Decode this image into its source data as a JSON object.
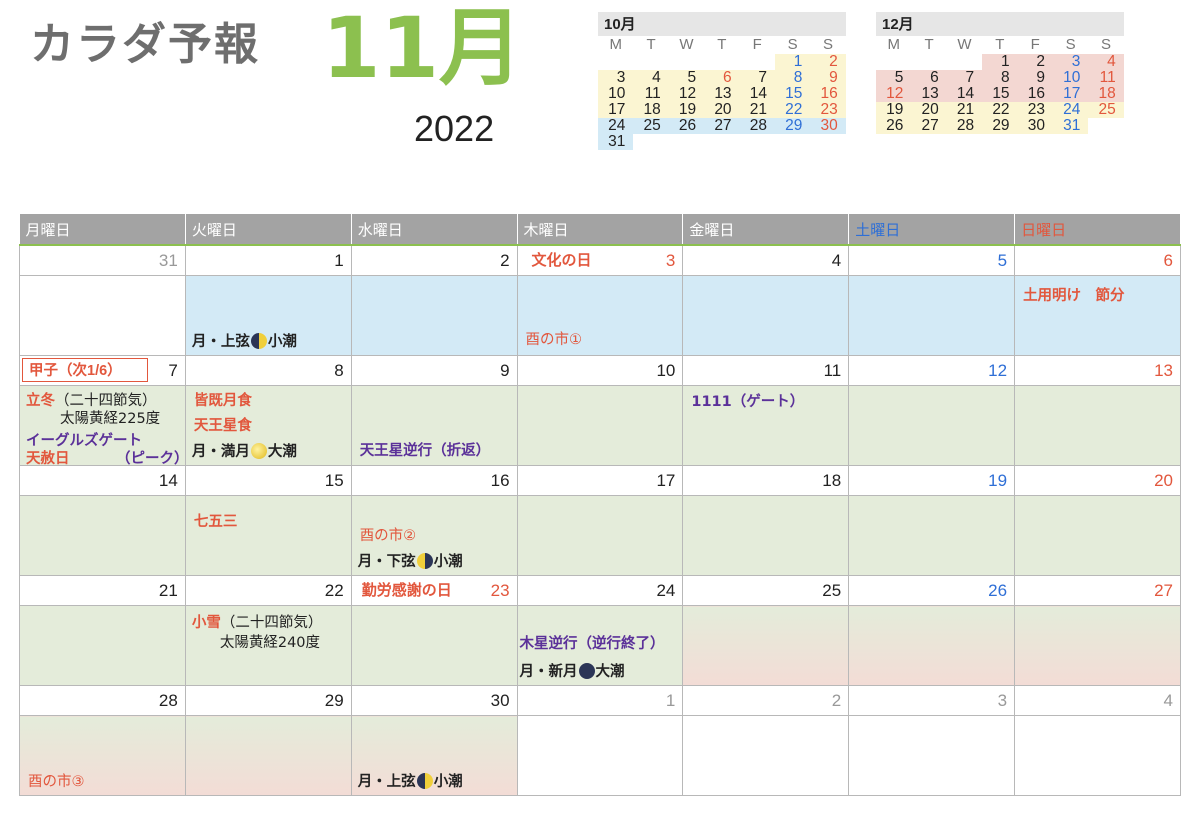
{
  "header": {
    "title": "カラダ予報",
    "month": "11月",
    "year": "2022"
  },
  "mini_oct": {
    "label": "10月",
    "dow": [
      "M",
      "T",
      "W",
      "T",
      "F",
      "S",
      "S"
    ],
    "weeks": [
      [
        "",
        "",
        "",
        "",
        "",
        "1",
        "2"
      ],
      [
        "3",
        "4",
        "5",
        "6",
        "7",
        "8",
        "9"
      ],
      [
        "10",
        "11",
        "12",
        "13",
        "14",
        "15",
        "16"
      ],
      [
        "17",
        "18",
        "19",
        "20",
        "21",
        "22",
        "23"
      ],
      [
        "24",
        "25",
        "26",
        "27",
        "28",
        "29",
        "30"
      ],
      [
        "31",
        "",
        "",
        "",
        "",
        "",
        ""
      ]
    ]
  },
  "mini_dec": {
    "label": "12月",
    "dow": [
      "M",
      "T",
      "W",
      "T",
      "F",
      "S",
      "S"
    ],
    "weeks": [
      [
        "",
        "",
        "",
        "1",
        "2",
        "3",
        "4"
      ],
      [
        "5",
        "6",
        "7",
        "8",
        "9",
        "10",
        "11"
      ],
      [
        "12",
        "13",
        "14",
        "15",
        "16",
        "17",
        "18"
      ],
      [
        "19",
        "20",
        "21",
        "22",
        "23",
        "24",
        "25"
      ],
      [
        "26",
        "27",
        "28",
        "29",
        "30",
        "31",
        ""
      ]
    ]
  },
  "weekdays": [
    "月曜日",
    "火曜日",
    "水曜日",
    "木曜日",
    "金曜日",
    "土曜日",
    "日曜日"
  ],
  "weeks": [
    {
      "days": [
        "31",
        "1",
        "2",
        "3",
        "4",
        "5",
        "6"
      ]
    },
    {
      "days": [
        "7",
        "8",
        "9",
        "10",
        "11",
        "12",
        "13"
      ]
    },
    {
      "days": [
        "14",
        "15",
        "16",
        "17",
        "18",
        "19",
        "20"
      ]
    },
    {
      "days": [
        "21",
        "22",
        "23",
        "24",
        "25",
        "26",
        "27"
      ]
    },
    {
      "days": [
        "28",
        "29",
        "30",
        "1",
        "2",
        "3",
        "4"
      ]
    }
  ],
  "events": {
    "bunka": "文化の日",
    "w1_tue": "月・上弦",
    "w1_tue_tide": "小潮",
    "w1_thu": "酉の市①",
    "w1_sun": "土用明け　節分",
    "kasshi": "甲子（次1/6）",
    "rittou": "立冬",
    "rittou_sub": "（二十四節気）",
    "rittou_deg": "太陽黄経225度",
    "eagles": "イーグルズゲート",
    "tensha": "天赦日",
    "peak": "（ピーク）",
    "eclipse": "皆既月食",
    "uranus_occ": "天王星食",
    "w2_tue": "月・満月",
    "w2_tue_tide": "大潮",
    "uranus_retro": "天王星逆行（折返）",
    "gate1111": "1111（ゲート）",
    "shichigosan": "七五三",
    "tori2": "酉の市②",
    "w3_wed": "月・下弦",
    "w3_wed_tide": "小潮",
    "kinro": "勤労感謝の日",
    "shousetsu": "小雪",
    "shousetsu_sub": "（二十四節気）",
    "shousetsu_deg": "太陽黄経240度",
    "jupiter": "木星逆行（逆行終了）",
    "w4_thu": "月・新月",
    "w4_thu_tide": "大潮",
    "tori3": "酉の市③",
    "w5_wed": "月・上弦",
    "w5_wed_tide": "小潮"
  }
}
